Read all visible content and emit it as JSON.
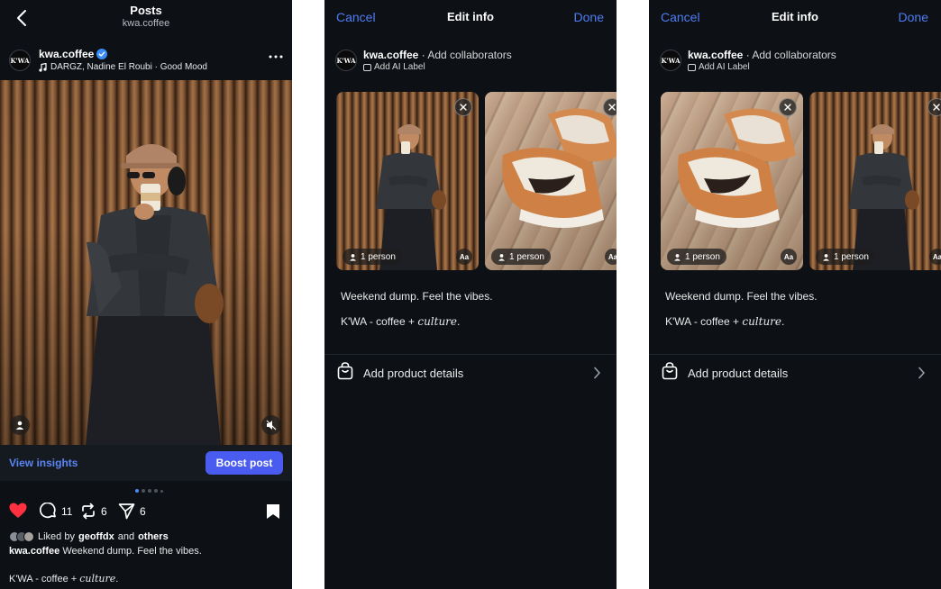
{
  "feed": {
    "header_title": "Posts",
    "header_subtitle": "kwa.coffee",
    "account_name": "kwa.coffee",
    "avatar_text": "K'WA",
    "music_text": "DARGZ, Nadine El Roubi · Good Mood",
    "view_insights_label": "View insights",
    "boost_label": "Boost post",
    "comment_count": "11",
    "repost_count": "6",
    "share_count": "6",
    "liked_by_prefix": "Liked by",
    "liked_by_user": "geoffdx",
    "liked_by_and": "and",
    "liked_by_others": "others",
    "caption_user": "kwa.coffee",
    "caption_text": "Weekend dump. Feel the vibes.",
    "tagline_prefix": "K'WA - coffee + ",
    "tagline_word": "culture",
    "tagline_suffix": "."
  },
  "edit": {
    "cancel_label": "Cancel",
    "title": "Edit info",
    "done_label": "Done",
    "account_name": "kwa.coffee",
    "avatar_text": "K'WA",
    "separator": " · ",
    "add_collaborators_label": "Add collaborators",
    "ai_label": "Add AI Label",
    "person_tag_label": "1 person",
    "aa_label": "Aa",
    "caption": "Weekend dump. Feel the vibes.",
    "tagline_prefix": "K'WA - coffee + ",
    "tagline_word": "culture",
    "tagline_suffix": ".",
    "product_label": "Add product details"
  },
  "colors": {
    "accent_blue": "#4e7cf2",
    "boost_blue": "#4a5cf0",
    "like_red": "#ff3040",
    "panel_bg": "#0d1116"
  },
  "icons": [
    "back-chevron-icon",
    "verified-badge-icon",
    "music-note-icon",
    "more-dots-icon",
    "person-tag-icon",
    "mute-icon",
    "heart-icon",
    "comment-icon",
    "repost-icon",
    "share-icon",
    "bookmark-icon",
    "close-icon",
    "shopping-bag-icon",
    "chevron-right-icon",
    "ai-label-icon"
  ]
}
